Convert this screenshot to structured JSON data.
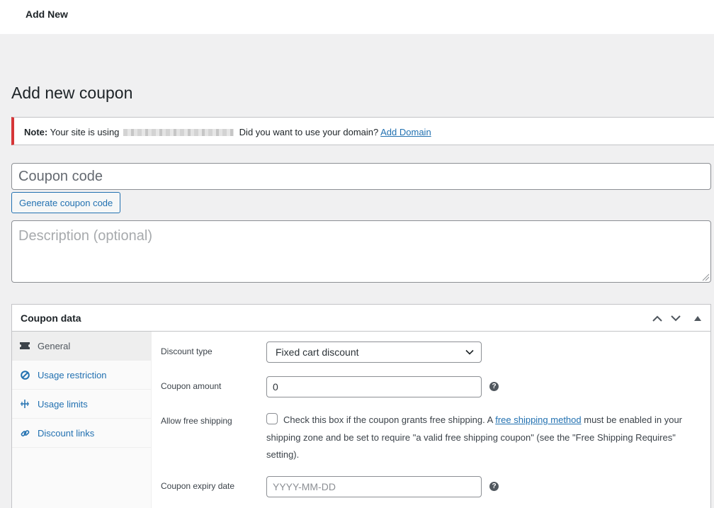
{
  "topbar": {
    "add_new": "Add New"
  },
  "page_title": "Add new coupon",
  "notice": {
    "label": "Note:",
    "text_before": "Your site is using",
    "text_after": "Did you want to use your domain?",
    "link": "Add Domain"
  },
  "coupon_code": {
    "placeholder": "Coupon code",
    "value": ""
  },
  "generate_button": "Generate coupon code",
  "description": {
    "placeholder": "Description (optional)",
    "value": ""
  },
  "coupon_data": {
    "title": "Coupon data",
    "tabs": [
      {
        "label": "General",
        "icon": "ticket-icon",
        "active": true
      },
      {
        "label": "Usage restriction",
        "icon": "prohibited-icon",
        "active": false
      },
      {
        "label": "Usage limits",
        "icon": "limits-icon",
        "active": false
      },
      {
        "label": "Discount links",
        "icon": "link-icon",
        "active": false
      }
    ],
    "general": {
      "discount_type": {
        "label": "Discount type",
        "selected": "Fixed cart discount"
      },
      "coupon_amount": {
        "label": "Coupon amount",
        "value": "0"
      },
      "free_shipping": {
        "label": "Allow free shipping",
        "text_before": "Check this box if the coupon grants free shipping. A",
        "link": "free shipping method",
        "text_after": "must be enabled in your shipping zone and be set to require \"a valid free shipping coupon\" (see the \"Free Shipping Requires\" setting).",
        "checked": false
      },
      "expiry_date": {
        "label": "Coupon expiry date",
        "placeholder": "YYYY-MM-DD",
        "value": ""
      }
    }
  },
  "colors": {
    "accent": "#2271b1",
    "notice_border": "#d63638"
  }
}
